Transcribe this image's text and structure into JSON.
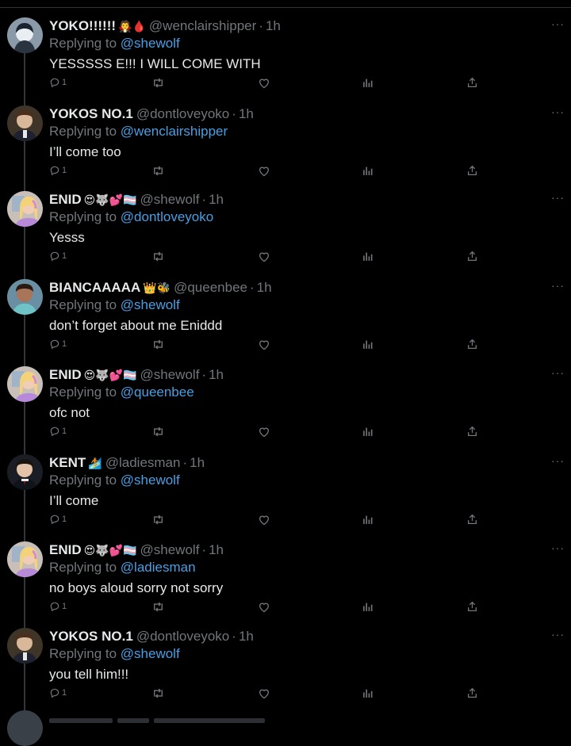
{
  "ui": {
    "more_glyph": "···",
    "replying_prefix": "Replying to ",
    "dot": "·"
  },
  "colors": {
    "background": "#000000",
    "text": "#e7e9ea",
    "muted": "#71767b",
    "mention": "#4a9ee3",
    "thread_line": "#333639"
  },
  "replies": [
    {
      "name": "YOKO!!!!!!",
      "emoji": "🧛🩸",
      "handle": "@wenclairshipper",
      "time": "1h",
      "replying_to": "@shewolf",
      "text": "YESSSSS E!!! I WILL COME WITH",
      "reply_count": "1",
      "avatar": "yoko"
    },
    {
      "name": "YOKOS NO.1",
      "emoji": "",
      "handle": "@dontloveyoko",
      "time": "1h",
      "replying_to": "@wenclairshipper",
      "text": "I’ll come too",
      "reply_count": "1",
      "avatar": "boy"
    },
    {
      "name": "ENID",
      "emoji": "😍🐺💕🏳️‍⚧️",
      "handle": "@shewolf",
      "time": "1h",
      "replying_to": "@dontloveyoko",
      "text": "Yesss",
      "reply_count": "1",
      "avatar": "enid"
    },
    {
      "name": "BIANCAAAAA",
      "emoji": "👑🐝",
      "handle": "@queenbee",
      "time": "1h",
      "replying_to": "@shewolf",
      "text": "don’t forget about me Eniddd",
      "reply_count": "1",
      "avatar": "bianca"
    },
    {
      "name": "ENID",
      "emoji": "😍🐺💕🏳️‍⚧️",
      "handle": "@shewolf",
      "time": "1h",
      "replying_to": "@queenbee",
      "text": "ofc not",
      "reply_count": "1",
      "avatar": "enid"
    },
    {
      "name": "KENT",
      "emoji": "🏄",
      "handle": "@ladiesman",
      "time": "1h",
      "replying_to": "@shewolf",
      "text": "I’ll come",
      "reply_count": "1",
      "avatar": "kent"
    },
    {
      "name": "ENID",
      "emoji": "😍🐺💕🏳️‍⚧️",
      "handle": "@shewolf",
      "time": "1h",
      "replying_to": "@ladiesman",
      "text": "no boys aloud sorry not sorry",
      "reply_count": "1",
      "avatar": "enid"
    },
    {
      "name": "YOKOS NO.1",
      "emoji": "",
      "handle": "@dontloveyoko",
      "time": "1h",
      "replying_to": "@shewolf",
      "text": "you tell him!!!",
      "reply_count": "1",
      "avatar": "boy"
    }
  ]
}
